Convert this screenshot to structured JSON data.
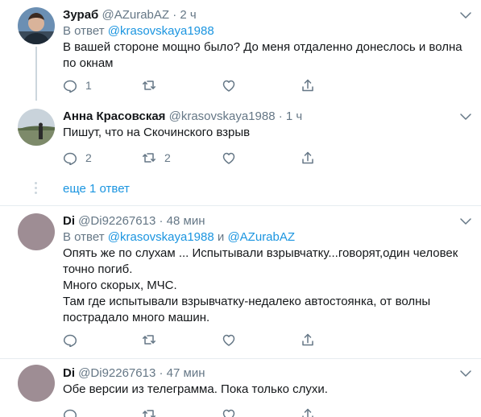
{
  "tweets": [
    {
      "name": "Зураб",
      "handle": "@AZurabAZ",
      "dot": "·",
      "time": "2 ч",
      "reply_prefix": "В ответ",
      "reply_users": [
        "@krasovskaya1988"
      ],
      "text": [
        "В вашей стороне мощно было? До меня отдаленно донеслось и волна",
        "по окнам"
      ],
      "replies": "1",
      "retweets": "",
      "likes": ""
    },
    {
      "name": "Анна Красовская",
      "handle": "@krasovskaya1988",
      "dot": "·",
      "time": "1 ч",
      "text": [
        "Пишут, что на Скочинского взрыв"
      ],
      "replies": "2",
      "retweets": "2",
      "likes": ""
    },
    {
      "name": "Di",
      "handle": "@Di92267613",
      "dot": "·",
      "time": "48 мин",
      "reply_prefix": "В ответ",
      "reply_users": [
        "@krasovskaya1988",
        "@AZurabAZ"
      ],
      "reply_joiner": "и",
      "text": [
        "Опять же по слухам ... Испытывали взрывчатку...говорят,один человек",
        "точно погиб.",
        "Много скорых, МЧС.",
        "Там где испытывали взрывчатку-недалеко  автостоянка, от волны",
        "пострадало много машин."
      ],
      "replies": "",
      "retweets": "",
      "likes": ""
    },
    {
      "name": "Di",
      "handle": "@Di92267613",
      "dot": "·",
      "time": "47 мин",
      "text": [
        "Обе версии из телеграмма. Пока только слухи."
      ]
    }
  ],
  "show_more": "еще 1 ответ",
  "colors": {
    "link": "#1b95e0",
    "muted": "#657786",
    "separator": "#e6ecf0",
    "thread_line": "#ccd6dd"
  },
  "icons": [
    "reply-icon",
    "retweet-icon",
    "like-icon",
    "share-icon",
    "caret-down-icon"
  ]
}
